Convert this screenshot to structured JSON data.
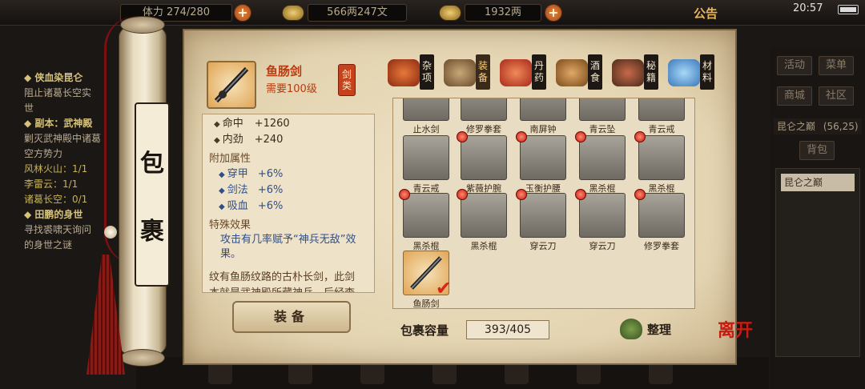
{
  "topbar": {
    "stamina": "体力 274/280",
    "silver": "566两247文",
    "gold": "1932两",
    "announce": "公告",
    "time": "20:57"
  },
  "quests": [
    {
      "title": "◆ 侠血染昆仑",
      "lines": [
        "阻止诸葛长空实",
        "世"
      ],
      "progress": []
    },
    {
      "title": "◆ 副本：武神殿",
      "lines": [
        "剿灭武神殿中诸葛",
        "空方势力"
      ],
      "progress": [
        "风林火山：1/1",
        "李雷云：1/1",
        "诸葛长空：0/1"
      ]
    },
    {
      "title": "◆ 田鹏的身世",
      "lines": [
        "寻找裘啸天询问",
        "的身世之谜"
      ],
      "progress": []
    }
  ],
  "sidemenu": {
    "buttons": [
      "活动",
      "菜单",
      "商城",
      "社区"
    ],
    "location": "昆仑之巅",
    "coords": "(56,25)",
    "backpack_tab": "背包",
    "panel_item": "昆仑之巅"
  },
  "scroll_title": [
    "包",
    "裹"
  ],
  "item": {
    "name": "鱼肠剑",
    "requirement": "需要100级",
    "type": [
      "剑",
      "类"
    ],
    "stats": [
      {
        "name": "命中",
        "value": "+1260"
      },
      {
        "name": "内劲",
        "value": "+240"
      }
    ],
    "bonus_title": "附加属性",
    "bonuses": [
      {
        "name": "穿甲",
        "value": "+6%"
      },
      {
        "name": "剑法",
        "value": "+6%"
      },
      {
        "name": "吸血",
        "value": "+6%"
      }
    ],
    "special_title": "特殊效果",
    "special_text": "攻击有几率赋予“神兵无敌”效果。",
    "description": "纹有鱼肠纹路的古朴长剑，此剑本就是武神殿所藏神兵，后经李雷云之手后转手你的手中"
  },
  "equip_label": "装备",
  "tabs": [
    {
      "label": "杂项",
      "icon": "misc-jar-icon",
      "color": "#c4462a"
    },
    {
      "label": "装备",
      "icon": "equipment-icon",
      "color": "#8a6a44",
      "active": true
    },
    {
      "label": "丹药",
      "icon": "pill-icon",
      "color": "#d84a2a"
    },
    {
      "label": "酒食",
      "icon": "wine-food-icon",
      "color": "#b87a3a"
    },
    {
      "label": "秘籍",
      "icon": "manual-book-icon",
      "color": "#5a3a2a"
    },
    {
      "label": "材料",
      "icon": "material-crystal-icon",
      "color": "#5a9ad8"
    }
  ],
  "inventory": [
    {
      "name": "止水剑",
      "icon": "sword-icon",
      "dot": false
    },
    {
      "name": "修罗拳套",
      "icon": "gauntlet-icon",
      "dot": false
    },
    {
      "name": "南屏钟",
      "icon": "bell-icon",
      "dot": false
    },
    {
      "name": "青云坠",
      "icon": "pendant-icon",
      "dot": false
    },
    {
      "name": "青云戒",
      "icon": "ring-icon",
      "dot": false
    },
    {
      "name": "青云戒",
      "icon": "ring-icon",
      "dot": false
    },
    {
      "name": "紫薇护腕",
      "icon": "bracer-icon",
      "dot": true
    },
    {
      "name": "玉衡护腰",
      "icon": "belt-icon",
      "dot": true
    },
    {
      "name": "黑杀棍",
      "icon": "staff-icon",
      "dot": true
    },
    {
      "name": "黑杀棍",
      "icon": "staff-icon",
      "dot": true
    },
    {
      "name": "黑杀棍",
      "icon": "staff-icon",
      "dot": true
    },
    {
      "name": "黑杀棍",
      "icon": "staff-icon",
      "dot": true
    },
    {
      "name": "穿云刀",
      "icon": "blade-icon",
      "dot": true
    },
    {
      "name": "穿云刀",
      "icon": "blade-icon",
      "dot": true
    },
    {
      "name": "修罗拳套",
      "icon": "gauntlet-icon",
      "dot": true
    },
    {
      "name": "鱼肠剑",
      "icon": "sword-icon",
      "dot": false,
      "selected": true
    }
  ],
  "capacity_label": "包裹容量",
  "capacity_value": "393/405",
  "sort_label": "整理",
  "leave_label": "离开",
  "colors": {
    "accent": "#b83a10",
    "bonus": "#2f4f8a",
    "paper": "#e8dcc2"
  }
}
